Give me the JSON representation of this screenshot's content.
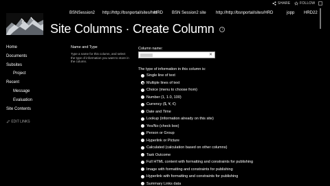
{
  "topbar": {
    "share_label": "SHARE",
    "follow_label": "FOLLOW"
  },
  "suite_links": [
    "BSNSession2",
    "http://http://bsnportal/sites/hrd",
    "HRD",
    "BSN Session2 site",
    "http://http://bsnportal/sites/HRD",
    "jopp",
    "HRD22"
  ],
  "page": {
    "title": "Site Columns",
    "separator": "·",
    "subtitle": "Create Column"
  },
  "nav": {
    "items": [
      {
        "label": "Home",
        "level": 0
      },
      {
        "label": "Documents",
        "level": 0
      },
      {
        "label": "Subsites",
        "level": 0
      },
      {
        "label": "Project",
        "level": 1
      },
      {
        "label": "Recent",
        "level": 0
      },
      {
        "label": "Message",
        "level": 1
      },
      {
        "label": "Evaluation",
        "level": 1
      },
      {
        "label": "Site Contents",
        "level": 0
      }
    ],
    "edit_links_label": "EDIT LINKS"
  },
  "form": {
    "section_title": "Name and Type",
    "section_desc": "Type a name for this column, and select the type of information you want to store in the column.",
    "column_name_label": "Column name:",
    "column_name_value": "",
    "type_label": "The type of information in this column is:",
    "selected_index": 1,
    "types": [
      "Single line of text",
      "Multiple lines of text",
      "Choice (menu to choose from)",
      "Number (1, 1.0, 100)",
      "Currency ($, ¥, €)",
      "Date and Time",
      "Lookup (information already on this site)",
      "Yes/No (check box)",
      "Person or Group",
      "Hyperlink or Picture",
      "Calculated (calculation based on other columns)",
      "Task Outcome",
      "Full HTML content with formatting and constraints for publishing",
      "Image with formatting and constraints for publishing",
      "Hyperlink with formatting and constraints for publishing",
      "Summary Links data"
    ]
  }
}
